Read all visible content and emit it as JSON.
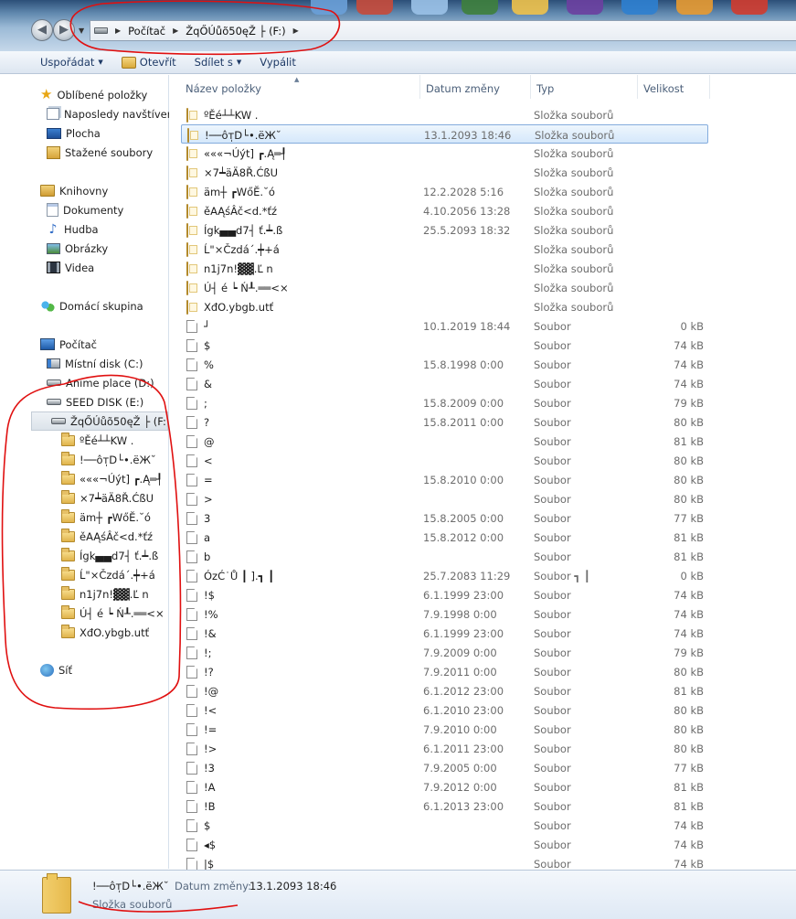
{
  "address_bar": {
    "crumbs": [
      "Počítač",
      "ŽqŐÚůõ50ęŽ ├ (F:)"
    ]
  },
  "toolbar": {
    "organize": "Uspořádat",
    "open": "Otevřít",
    "share": "Sdílet s",
    "burn": "Vypálit"
  },
  "nav": {
    "favorites": {
      "label": "Oblíbené položky",
      "items": [
        "Naposledy navštíver",
        "Plocha",
        "Stažené soubory"
      ]
    },
    "libraries": {
      "label": "Knihovny",
      "items": [
        "Dokumenty",
        "Hudba",
        "Obrázky",
        "Videa"
      ]
    },
    "homegroup": "Domácí skupina",
    "computer": {
      "label": "Počítač",
      "drives": [
        "Místní disk (C:)",
        "Anime place (D:)",
        "SEED DISK (E:)",
        "ŽqŐÚůõ50ęŽ ├ (F:)"
      ]
    },
    "folders": [
      "ºĚé┴┴KW .",
      "!──ôт̩D└•.ëЖ˘",
      "«««¬Úýt] ┏.Ą═┦",
      "×7┷äÄ8Ř.ĆßU",
      "äm┼ ┏WőĔ.˘ó",
      "ěAĄśÂč<d.*ťź",
      "Ígk▄▄d7┤ ť.┷.ß",
      "Ĺ\"×Čzdá´.┿+á",
      " n1j7n!▓▓.Ľ n",
      "Ú┤ é ┕ Ń┸.══<×",
      "XđO.ybgb.utť"
    ],
    "network": "Síť"
  },
  "columns": {
    "name": "Název položky",
    "date": "Datum změny",
    "type": "Typ",
    "size": "Velikost"
  },
  "files": [
    {
      "name": "ºĚé┴┴KW .",
      "date": "",
      "type": "Složka souborů",
      "size": "",
      "kind": "folder",
      "selected": false
    },
    {
      "name": "!──ôт̩D└•.ëЖ˘",
      "date": "13.1.2093 18:46",
      "type": "Složka souborů",
      "size": "",
      "kind": "folder",
      "selected": true
    },
    {
      "name": "«««¬Úýt] ┏.Ą═┦",
      "date": "",
      "type": "Složka souborů",
      "size": "",
      "kind": "folder",
      "selected": false
    },
    {
      "name": "×7┷äÄ8Ř.ĆßU",
      "date": "",
      "type": "Složka souborů",
      "size": "",
      "kind": "folder",
      "selected": false
    },
    {
      "name": "äm┼ ┏WőĔ.˘ó",
      "date": "12.2.2028 5:16",
      "type": "Složka souborů",
      "size": "",
      "kind": "folder",
      "selected": false
    },
    {
      "name": "ěAĄśÂč<d.*ťź",
      "date": "4.10.2056 13:28",
      "type": "Složka souborů",
      "size": "",
      "kind": "folder",
      "selected": false
    },
    {
      "name": "Ígk▄▄d7┤ ť.┷.ß",
      "date": "25.5.2093 18:32",
      "type": "Složka souborů",
      "size": "",
      "kind": "folder",
      "selected": false
    },
    {
      "name": "Ĺ\"×Čzdá´.┿+á",
      "date": "",
      "type": "Složka souborů",
      "size": "",
      "kind": "folder",
      "selected": false
    },
    {
      "name": " n1j7n!▓▓.Ľ n",
      "date": "",
      "type": "Složka souborů",
      "size": "",
      "kind": "folder",
      "selected": false
    },
    {
      "name": "Ú┤ é ┕ Ń┸.══<×",
      "date": "",
      "type": "Složka souborů",
      "size": "",
      "kind": "folder",
      "selected": false
    },
    {
      "name": "XđO.ybgb.utť",
      "date": "",
      "type": "Složka souborů",
      "size": "",
      "kind": "folder",
      "selected": false
    },
    {
      "name": "┘",
      "date": "10.1.2019 18:44",
      "type": "Soubor",
      "size": "0 kB",
      "kind": "file",
      "selected": false
    },
    {
      "name": "$",
      "date": "",
      "type": "Soubor",
      "size": "74 kB",
      "kind": "file",
      "selected": false
    },
    {
      "name": "%",
      "date": "15.8.1998 0:00",
      "type": "Soubor",
      "size": "74 kB",
      "kind": "file",
      "selected": false
    },
    {
      "name": "&",
      "date": "",
      "type": "Soubor",
      "size": "74 kB",
      "kind": "file",
      "selected": false
    },
    {
      "name": ";",
      "date": "15.8.2009 0:00",
      "type": "Soubor",
      "size": "79 kB",
      "kind": "file",
      "selected": false
    },
    {
      "name": "?",
      "date": "15.8.2011 0:00",
      "type": "Soubor",
      "size": "80 kB",
      "kind": "file",
      "selected": false
    },
    {
      "name": "@",
      "date": "",
      "type": "Soubor",
      "size": "81 kB",
      "kind": "file",
      "selected": false
    },
    {
      "name": "<",
      "date": "",
      "type": "Soubor",
      "size": "80 kB",
      "kind": "file",
      "selected": false
    },
    {
      "name": "=",
      "date": "15.8.2010 0:00",
      "type": "Soubor",
      "size": "80 kB",
      "kind": "file",
      "selected": false
    },
    {
      "name": ">",
      "date": "",
      "type": "Soubor",
      "size": "80 kB",
      "kind": "file",
      "selected": false
    },
    {
      "name": "3",
      "date": "15.8.2005 0:00",
      "type": "Soubor",
      "size": "77 kB",
      "kind": "file",
      "selected": false
    },
    {
      "name": "a",
      "date": "15.8.2012 0:00",
      "type": "Soubor",
      "size": "81 kB",
      "kind": "file",
      "selected": false
    },
    {
      "name": "b",
      "date": "",
      "type": "Soubor",
      "size": "81 kB",
      "kind": "file",
      "selected": false
    },
    {
      "name": "ÓzĆ˙Ů ┃ ].┓  ┃",
      "date": "25.7.2083 11:29",
      "type": "Soubor ┓  ┃",
      "size": "0 kB",
      "kind": "file",
      "selected": false
    },
    {
      "name": "!$",
      "date": "6.1.1999 23:00",
      "type": "Soubor",
      "size": "74 kB",
      "kind": "file",
      "selected": false
    },
    {
      "name": "!%",
      "date": "7.9.1998 0:00",
      "type": "Soubor",
      "size": "74 kB",
      "kind": "file",
      "selected": false
    },
    {
      "name": "!&",
      "date": "6.1.1999 23:00",
      "type": "Soubor",
      "size": "74 kB",
      "kind": "file",
      "selected": false
    },
    {
      "name": "!;",
      "date": "7.9.2009 0:00",
      "type": "Soubor",
      "size": "79 kB",
      "kind": "file",
      "selected": false
    },
    {
      "name": "!?",
      "date": "7.9.2011 0:00",
      "type": "Soubor",
      "size": "80 kB",
      "kind": "file",
      "selected": false
    },
    {
      "name": "!@",
      "date": "6.1.2012 23:00",
      "type": "Soubor",
      "size": "81 kB",
      "kind": "file",
      "selected": false
    },
    {
      "name": "!<",
      "date": "6.1.2010 23:00",
      "type": "Soubor",
      "size": "80 kB",
      "kind": "file",
      "selected": false
    },
    {
      "name": "!=",
      "date": "7.9.2010 0:00",
      "type": "Soubor",
      "size": "80 kB",
      "kind": "file",
      "selected": false
    },
    {
      "name": "!>",
      "date": "6.1.2011 23:00",
      "type": "Soubor",
      "size": "80 kB",
      "kind": "file",
      "selected": false
    },
    {
      "name": "!3",
      "date": "7.9.2005 0:00",
      "type": "Soubor",
      "size": "77 kB",
      "kind": "file",
      "selected": false
    },
    {
      "name": "!A",
      "date": "7.9.2012 0:00",
      "type": "Soubor",
      "size": "81 kB",
      "kind": "file",
      "selected": false
    },
    {
      "name": "!B",
      "date": "6.1.2013 23:00",
      "type": "Soubor",
      "size": "81 kB",
      "kind": "file",
      "selected": false
    },
    {
      "name": "   $",
      "date": "",
      "type": "Soubor",
      "size": "74 kB",
      "kind": "file",
      "selected": false
    },
    {
      "name": "◂$",
      "date": "",
      "type": "Soubor",
      "size": "74 kB",
      "kind": "file",
      "selected": false
    },
    {
      "name": "|$",
      "date": "",
      "type": "Soubor",
      "size": "74 kB",
      "kind": "file",
      "selected": false
    }
  ],
  "details": {
    "name": "!──ôт̩D└•.ëЖ˘",
    "date_label": "Datum změny:",
    "date": "13.1.2093 18:46",
    "type": "Složka souborů"
  },
  "colors": {
    "accent": "#1e3a66",
    "selection_border": "#84acdd",
    "annotation": "#e01010",
    "folder": "#e0b44b"
  }
}
